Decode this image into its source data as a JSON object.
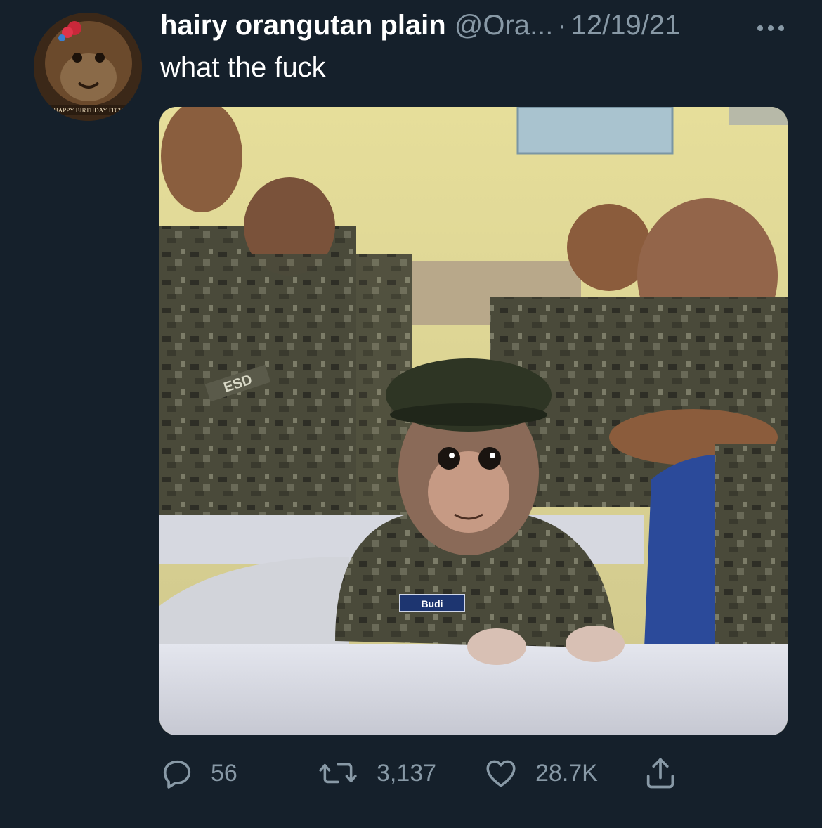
{
  "tweet": {
    "display_name": "hairy orangutan plain",
    "handle": "@Ora...",
    "separator": "·",
    "date": "12/19/21",
    "text": "what the fuck",
    "avatar_caption": "HAPPY BIRTHDAY ITCH",
    "image_nametag": "Budi",
    "image_patch": "ESD"
  },
  "actions": {
    "reply_count": "56",
    "retweet_count": "3,137",
    "like_count": "28.7K"
  },
  "icons": {
    "reply": "reply-icon",
    "retweet": "retweet-icon",
    "like": "heart-icon",
    "share": "share-icon",
    "more": "more-icon"
  },
  "colors": {
    "background": "#15202b",
    "primary_text": "#ffffff",
    "secondary_text": "#8899a6"
  }
}
